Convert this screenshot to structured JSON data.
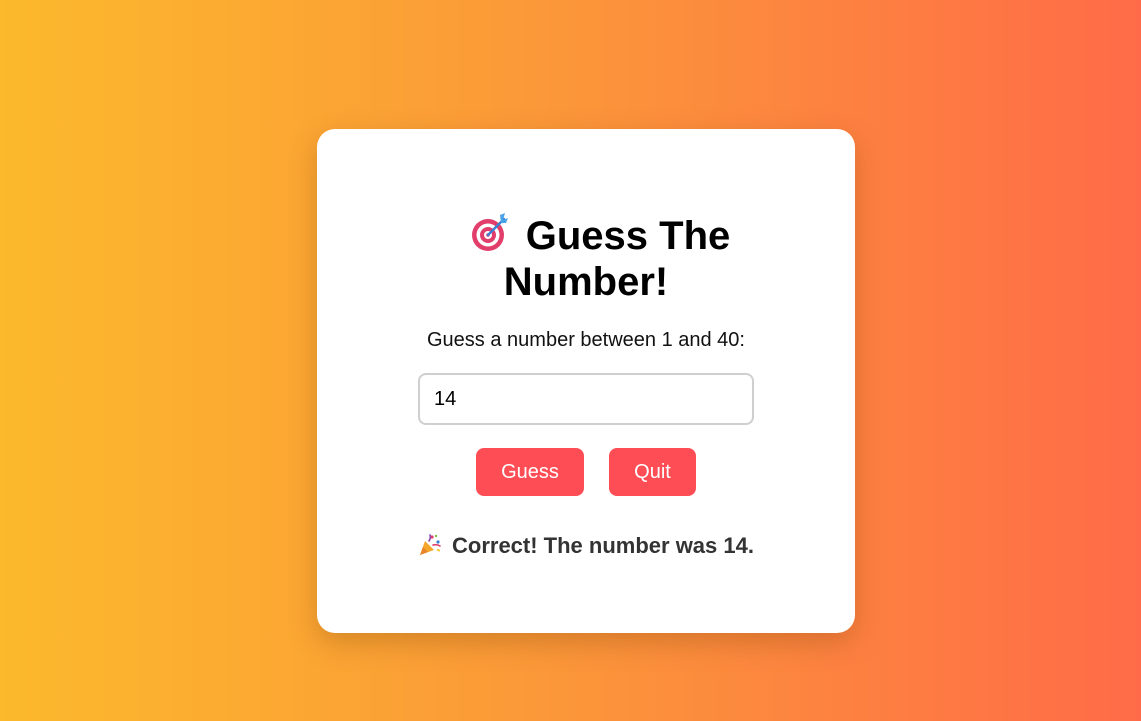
{
  "game": {
    "title_line1": "Guess The",
    "title_line2": "Number!",
    "title_icon": "target-dart-icon",
    "prompt": "Guess a number between 1 and 40:",
    "input_value": "14",
    "guess_button": "Guess",
    "quit_button": "Quit",
    "result_icon": "party-popper-icon",
    "result_text": "Correct! The number was 14."
  },
  "colors": {
    "background_gradient": [
      "#fcb92c",
      "#ff6b48"
    ],
    "button": "#ff4d55",
    "card": "#ffffff"
  }
}
